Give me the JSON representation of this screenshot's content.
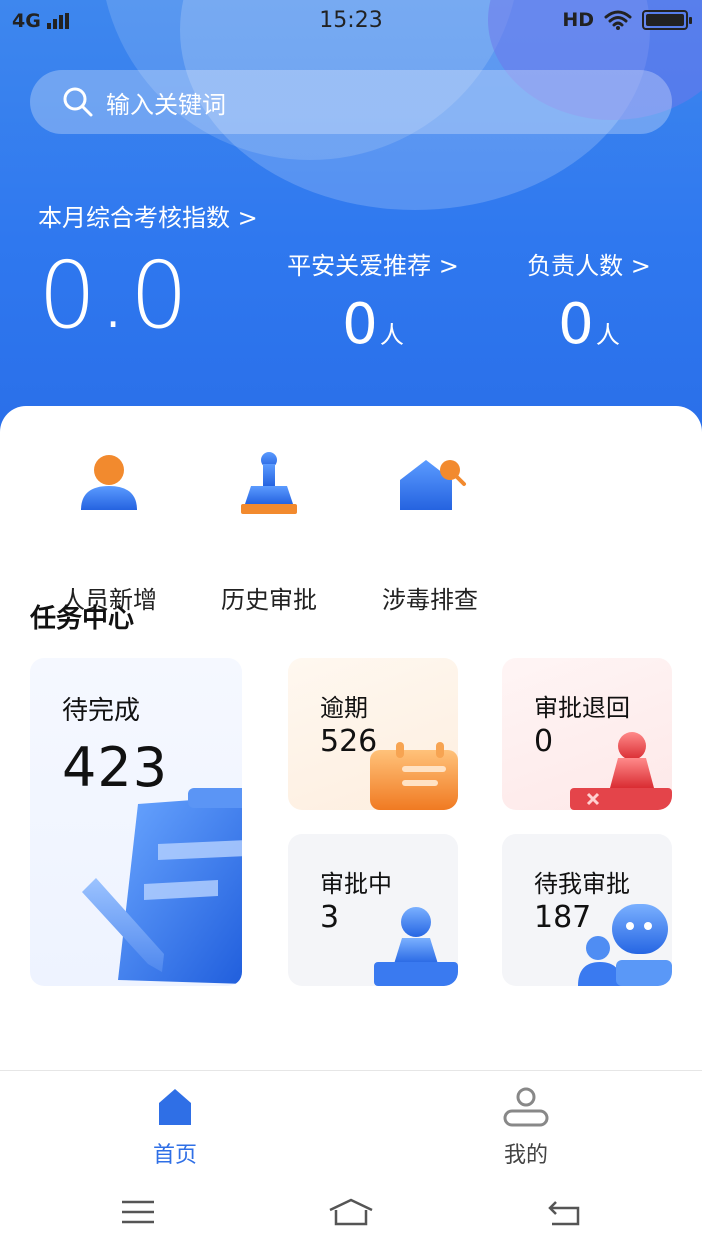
{
  "status_bar": {
    "network": "4G",
    "time": "15:23",
    "hd": "HD",
    "icons": [
      "signal-icon",
      "wifi-icon",
      "battery-icon"
    ]
  },
  "search": {
    "placeholder": "输入关键词",
    "icon": "search-icon"
  },
  "summary": {
    "index_label": "本月综合考核指数 >",
    "index_value": "0.0",
    "stats": [
      {
        "label": "平安关爱推荐 >",
        "value": "0",
        "unit": "人"
      },
      {
        "label": "负责人数 >",
        "value": "0",
        "unit": "人"
      }
    ]
  },
  "quick_actions": [
    {
      "label": "人员新增",
      "icon": "person-add-icon"
    },
    {
      "label": "历史审批",
      "icon": "stamp-icon"
    },
    {
      "label": "涉毒排查",
      "icon": "house-search-icon"
    }
  ],
  "task_center": {
    "title": "任务中心",
    "pending": {
      "label": "待完成",
      "value": "423",
      "icon": "clipboard-pencil-icon"
    },
    "overdue": {
      "label": "逾期",
      "value": "526",
      "icon": "calendar-icon"
    },
    "returned": {
      "label": "审批退回",
      "value": "0",
      "icon": "returned-stamp-icon"
    },
    "in_review": {
      "label": "审批中",
      "value": "3",
      "icon": "reviewer-icon"
    },
    "my_review": {
      "label": "待我审批",
      "value": "187",
      "icon": "chat-person-icon"
    }
  },
  "tabbar": {
    "items": [
      {
        "label": "首页",
        "icon": "home-icon",
        "active": true
      },
      {
        "label": "我的",
        "icon": "user-icon",
        "active": false
      }
    ]
  },
  "colors": {
    "brand_blue": "#2f6fe6",
    "header_blue": "#3e87ee",
    "orange_accent": "#f28a2e",
    "red_accent": "#e8454a"
  }
}
